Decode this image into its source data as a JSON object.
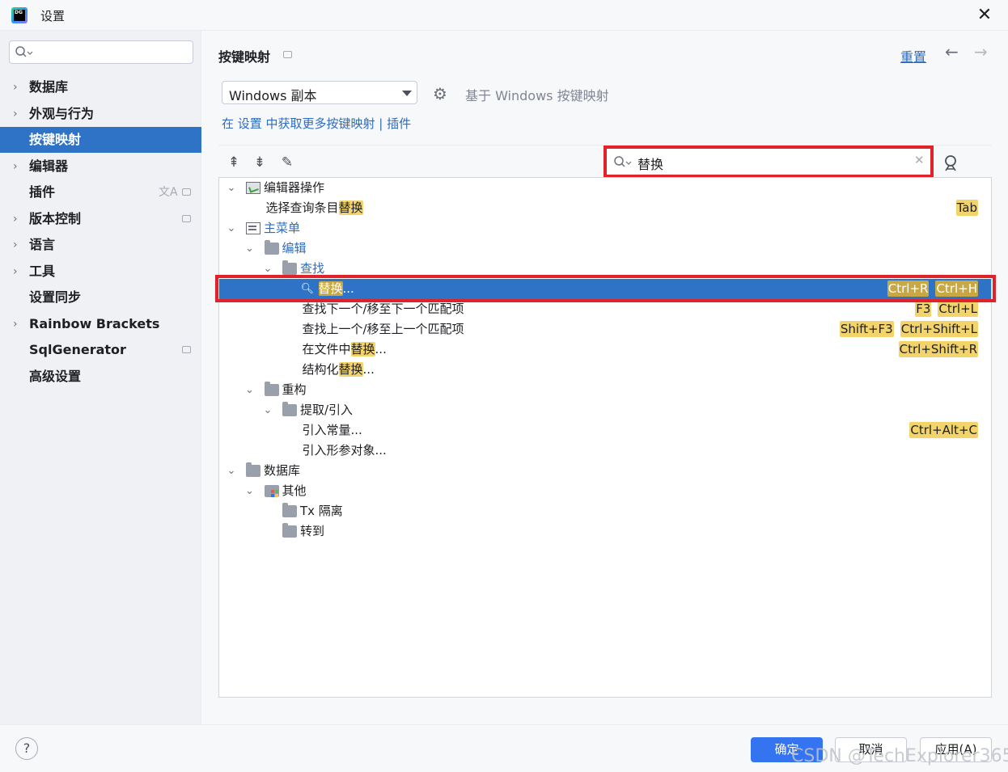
{
  "window": {
    "title": "设置",
    "logo_text": "DG"
  },
  "sidebar": {
    "search_value": "",
    "items": [
      {
        "label": "数据库",
        "expandable": true
      },
      {
        "label": "外观与行为",
        "expandable": true
      },
      {
        "label": "按键映射",
        "expandable": false,
        "selected": true
      },
      {
        "label": "编辑器",
        "expandable": true
      },
      {
        "label": "插件",
        "expandable": false
      },
      {
        "label": "版本控制",
        "expandable": true
      },
      {
        "label": "语言",
        "expandable": true
      },
      {
        "label": "工具",
        "expandable": true
      },
      {
        "label": "设置同步",
        "expandable": false
      },
      {
        "label": "Rainbow Brackets",
        "expandable": true
      },
      {
        "label": "SqlGenerator",
        "expandable": false
      },
      {
        "label": "高级设置",
        "expandable": false
      }
    ]
  },
  "header": {
    "title": "按键映射",
    "reset_label": "重置",
    "back_icon": "arrow-left-icon",
    "forward_icon": "arrow-right-icon"
  },
  "keymap": {
    "selected": "Windows 副本",
    "based_on": "基于 Windows 按键映射",
    "plugin_link": "在 设置 中获取更多按键映射 | 插件"
  },
  "search": {
    "value": "替换",
    "highlight": "替换"
  },
  "tree": [
    {
      "level": 0,
      "expanded": true,
      "icon": "editor-actions-icon",
      "before": "编辑器操作",
      "match": "",
      "after": "",
      "keys": []
    },
    {
      "level": 1,
      "leaf": true,
      "before": "选择查询条目",
      "match": "替换",
      "after": "",
      "keys": [
        "Tab"
      ]
    },
    {
      "level": 0,
      "expanded": true,
      "icon": "main-menu-icon",
      "before": "主菜单",
      "match": "",
      "after": "",
      "link": true,
      "keys": []
    },
    {
      "level": 1,
      "expanded": true,
      "icon": "folder-icon",
      "before": "编辑",
      "match": "",
      "after": "",
      "link": true,
      "keys": []
    },
    {
      "level": 2,
      "expanded": true,
      "icon": "folder-icon",
      "before": "查找",
      "match": "",
      "after": "",
      "link": true,
      "keys": []
    },
    {
      "level": 3,
      "leaf": true,
      "selected": true,
      "icon": "replace-icon",
      "before": "",
      "match": "替换",
      "after": "...",
      "keys": [
        "Ctrl+R",
        "Ctrl+H"
      ]
    },
    {
      "level": 3,
      "leaf": true,
      "before": "查找下一个/移至下一个匹配项",
      "match": "",
      "after": "",
      "keys": [
        "F3",
        "Ctrl+L"
      ]
    },
    {
      "level": 3,
      "leaf": true,
      "before": "查找上一个/移至上一个匹配项",
      "match": "",
      "after": "",
      "keys": [
        "Shift+F3",
        "Ctrl+Shift+L"
      ]
    },
    {
      "level": 3,
      "leaf": true,
      "before": "在文件中",
      "match": "替换",
      "after": "...",
      "keys": [
        "Ctrl+Shift+R"
      ]
    },
    {
      "level": 3,
      "leaf": true,
      "before": "结构化",
      "match": "替换",
      "after": "...",
      "keys": []
    },
    {
      "level": 1,
      "expanded": true,
      "icon": "folder-icon",
      "before": "重构",
      "match": "",
      "after": "",
      "keys": []
    },
    {
      "level": 2,
      "expanded": true,
      "icon": "folder-icon",
      "before": "提取/引入",
      "match": "",
      "after": "",
      "keys": []
    },
    {
      "level": 3,
      "leaf": true,
      "before": "引入常量...",
      "match": "",
      "after": "",
      "keys": [
        "Ctrl+Alt+C"
      ]
    },
    {
      "level": 3,
      "leaf": true,
      "before": "引入形参对象...",
      "match": "",
      "after": "",
      "keys": []
    },
    {
      "level": 0,
      "expanded": true,
      "icon": "folder-icon",
      "before": "数据库",
      "match": "",
      "after": "",
      "keys": []
    },
    {
      "level": 1,
      "expanded": true,
      "icon": "other-icon",
      "before": "其他",
      "match": "",
      "after": "",
      "keys": []
    },
    {
      "level": 2,
      "leaf": true,
      "icon": "folder-icon",
      "before": "Tx 隔离",
      "match": "",
      "after": "",
      "keys": []
    },
    {
      "level": 2,
      "leaf": true,
      "icon": "folder-icon",
      "before": "转到",
      "match": "",
      "after": "",
      "keys": []
    }
  ],
  "footer": {
    "help": "?",
    "ok": "确定",
    "cancel": "取消",
    "apply": "应用(A)",
    "watermark": "CSDN @TechExplorer365"
  },
  "colors": {
    "accent": "#3574f0",
    "selection": "#2f73c7",
    "highlight": "#f3d46b",
    "annotation": "#e0232b"
  }
}
